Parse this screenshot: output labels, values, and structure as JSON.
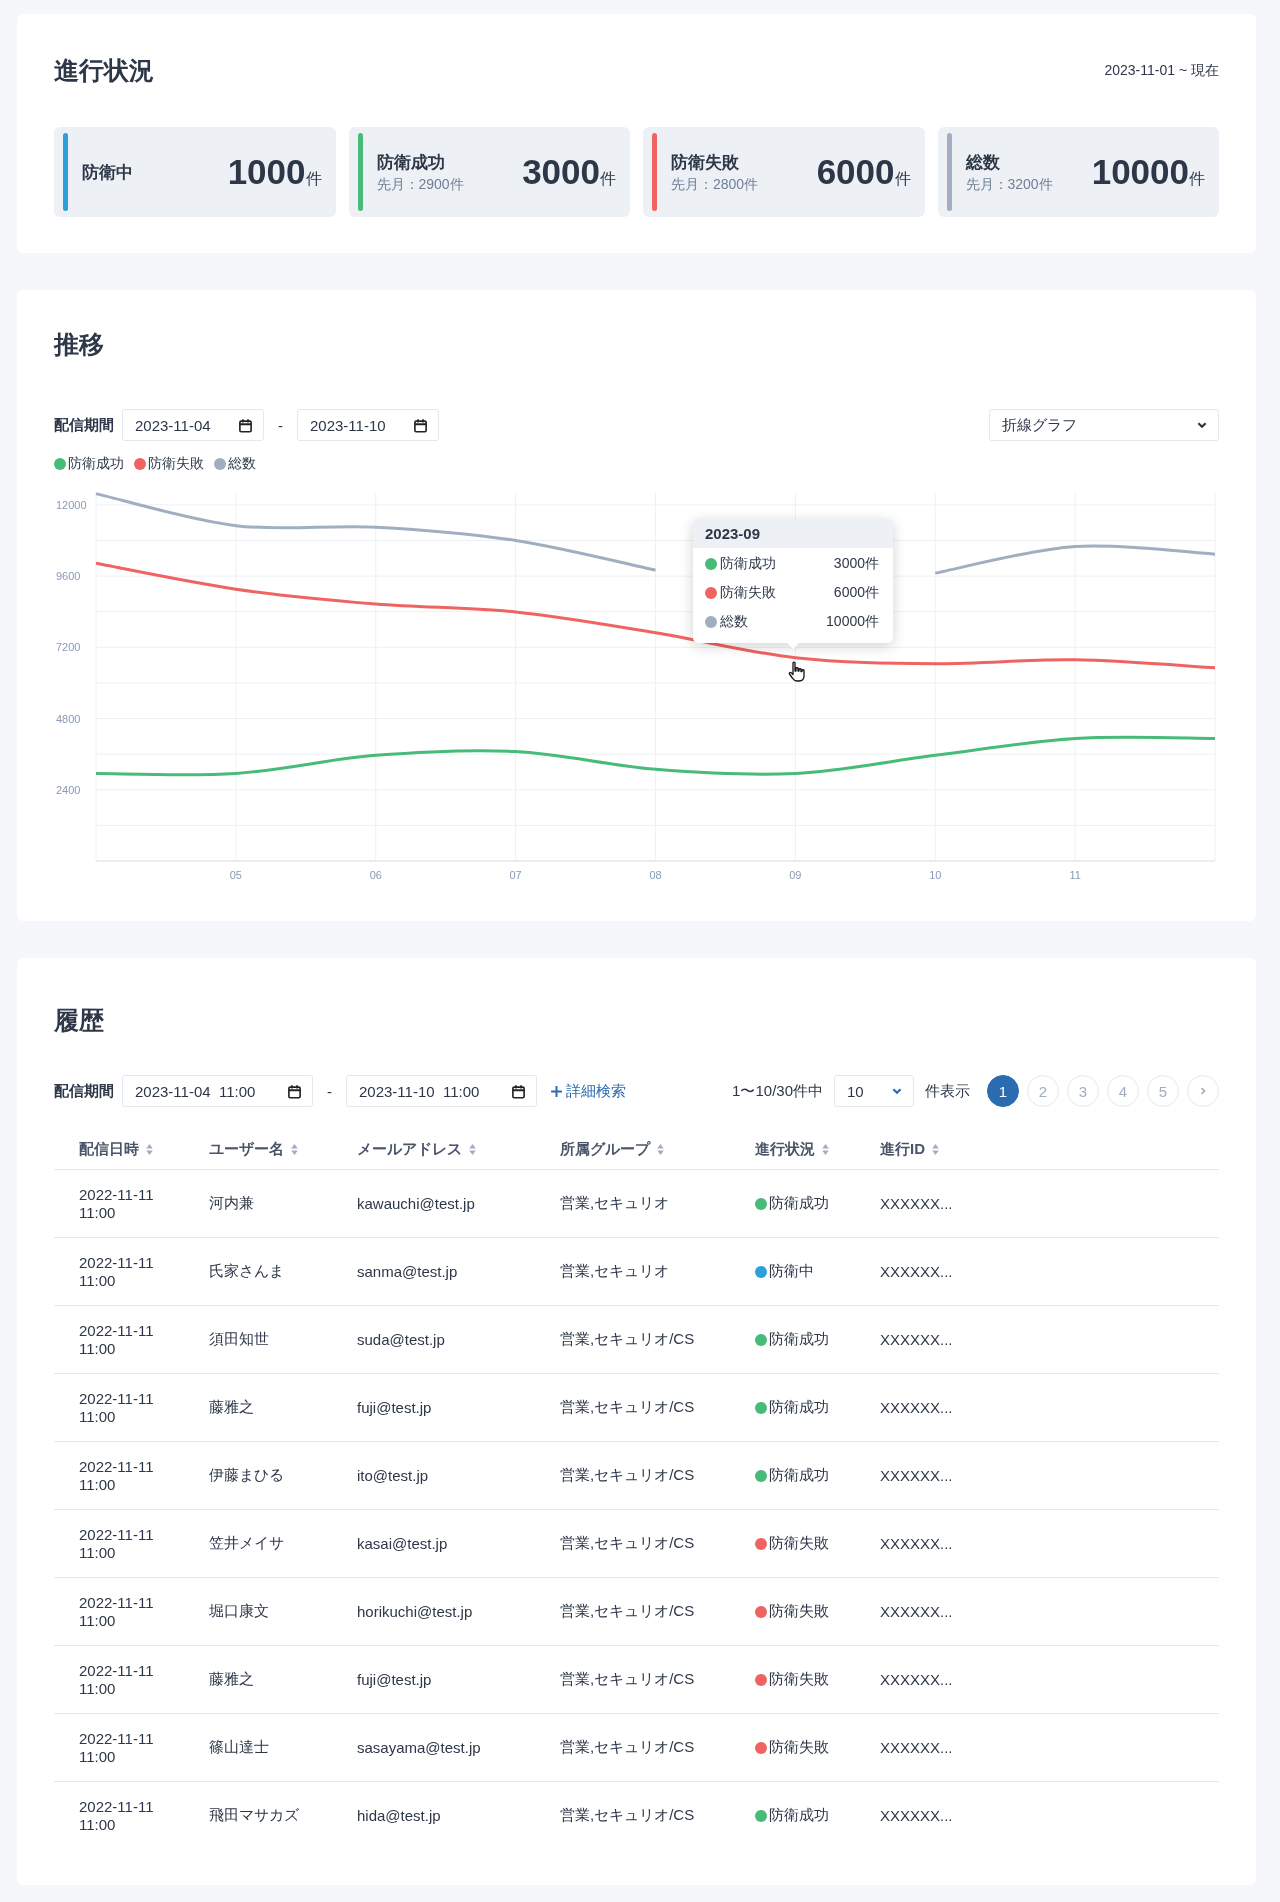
{
  "progress": {
    "title": "進行状況",
    "period": "2023-11-01 ~ 現在",
    "stats": [
      {
        "label": "防衛中",
        "value": "1000",
        "unit": "件",
        "color": "#2d9fd9"
      },
      {
        "label": "防衛成功",
        "sub": "先月：2900件",
        "value": "3000",
        "unit": "件",
        "color": "#48bb78"
      },
      {
        "label": "防衛失敗",
        "sub": "先月：2800件",
        "value": "6000",
        "unit": "件",
        "color": "#ef6461"
      },
      {
        "label": "総数",
        "sub": "先月：3200件",
        "value": "10000",
        "unit": "件",
        "color": "#a0aec0"
      }
    ]
  },
  "trend": {
    "title": "推移",
    "period_label": "配信期間",
    "date_from": "2023-11-04",
    "separator": "-",
    "date_to": "2023-11-10",
    "chart_type": "折線グラフ",
    "chart_data": {
      "type": "line",
      "x": [
        4,
        5,
        6,
        7,
        8,
        9,
        10,
        11,
        12
      ],
      "xlim": [
        4,
        12
      ],
      "xticks": [
        {
          "value": 5,
          "label": "05"
        },
        {
          "value": 6,
          "label": "06"
        },
        {
          "value": 7,
          "label": "07"
        },
        {
          "value": 8,
          "label": "08"
        },
        {
          "value": 9,
          "label": "09"
        },
        {
          "value": 10,
          "label": "10"
        },
        {
          "value": 11,
          "label": "11"
        }
      ],
      "ylim": [
        0,
        12400
      ],
      "grid": true,
      "legend": "top-left",
      "yticks": [
        2400,
        4800,
        7200,
        9600,
        12000
      ],
      "series": [
        {
          "name": "防衛成功",
          "color": "#48bb78",
          "values": [
            2950,
            2950,
            3560,
            3690,
            3090,
            2950,
            3560,
            4130,
            4130
          ]
        },
        {
          "name": "防衛失敗",
          "color": "#ef6461",
          "values": [
            10030,
            9160,
            8660,
            8390,
            7690,
            6850,
            6650,
            6780,
            6510
          ]
        },
        {
          "name": "総数",
          "color": "#a0aec0",
          "values": [
            12380,
            11300,
            11250,
            10800,
            9800,
            null,
            9700,
            10600,
            10340
          ]
        }
      ]
    },
    "tooltip": {
      "title": "2023-09",
      "rows": [
        {
          "label": "防衛成功",
          "value": "3000件",
          "color": "#48bb78"
        },
        {
          "label": "防衛失敗",
          "value": "6000件",
          "color": "#ef6461"
        },
        {
          "label": "総数",
          "value": "10000件",
          "color": "#a0aec0"
        }
      ]
    }
  },
  "history": {
    "title": "履歴",
    "period_label": "配信期間",
    "date_from": "2023-11-04  11:00",
    "separator": "-",
    "date_to": "2023-11-10  11:00",
    "advanced_search": "詳細検索",
    "range": "1〜10/30件中",
    "page_size": "10",
    "page_size_label": "件表示",
    "pages": [
      {
        "label": "1",
        "selected": true
      },
      {
        "label": "2",
        "selected": false
      },
      {
        "label": "3",
        "selected": false
      },
      {
        "label": "4",
        "selected": false
      },
      {
        "label": "5",
        "selected": false
      }
    ],
    "columns": [
      "配信日時",
      "ユーザー名",
      "メールアドレス",
      "所属グループ",
      "進行状況",
      "進行ID"
    ],
    "rows": [
      {
        "date": "2022-11-11",
        "time": "11:00",
        "user": "河内兼",
        "email": "kawauchi@test.jp",
        "group": "営業,セキュリオ",
        "status": "防衛成功",
        "color": "#48bb78",
        "id": "XXXXXX..."
      },
      {
        "date": "2022-11-11",
        "time": "11:00",
        "user": "氏家さんま",
        "email": "sanma@test.jp",
        "group": "営業,セキュリオ",
        "status": "防衛中",
        "color": "#2d9fd9",
        "id": "XXXXXX..."
      },
      {
        "date": "2022-11-11",
        "time": "11:00",
        "user": "須田知世",
        "email": "suda@test.jp",
        "group": "営業,セキュリオ/CS",
        "status": "防衛成功",
        "color": "#48bb78",
        "id": "XXXXXX..."
      },
      {
        "date": "2022-11-11",
        "time": "11:00",
        "user": "藤雅之",
        "email": "fuji@test.jp",
        "group": "営業,セキュリオ/CS",
        "status": "防衛成功",
        "color": "#48bb78",
        "id": "XXXXXX..."
      },
      {
        "date": "2022-11-11",
        "time": "11:00",
        "user": "伊藤まひる",
        "email": "ito@test.jp",
        "group": "営業,セキュリオ/CS",
        "status": "防衛成功",
        "color": "#48bb78",
        "id": "XXXXXX..."
      },
      {
        "date": "2022-11-11",
        "time": "11:00",
        "user": "笠井メイサ",
        "email": "kasai@test.jp",
        "group": "営業,セキュリオ/CS",
        "status": "防衛失敗",
        "color": "#ef6461",
        "id": "XXXXXX..."
      },
      {
        "date": "2022-11-11",
        "time": "11:00",
        "user": "堀口康文",
        "email": "horikuchi@test.jp",
        "group": "営業,セキュリオ/CS",
        "status": "防衛失敗",
        "color": "#ef6461",
        "id": "XXXXXX..."
      },
      {
        "date": "2022-11-11",
        "time": "11:00",
        "user": "藤雅之",
        "email": "fuji@test.jp",
        "group": "営業,セキュリオ/CS",
        "status": "防衛失敗",
        "color": "#ef6461",
        "id": "XXXXXX..."
      },
      {
        "date": "2022-11-11",
        "time": "11:00",
        "user": "篠山達士",
        "email": "sasayama@test.jp",
        "group": "営業,セキュリオ/CS",
        "status": "防衛失敗",
        "color": "#ef6461",
        "id": "XXXXXX..."
      },
      {
        "date": "2022-11-11",
        "time": "11:00",
        "user": "飛田マサカズ",
        "email": "hida@test.jp",
        "group": "営業,セキュリオ/CS",
        "status": "防衛成功",
        "color": "#48bb78",
        "id": "XXXXXX..."
      }
    ]
  }
}
